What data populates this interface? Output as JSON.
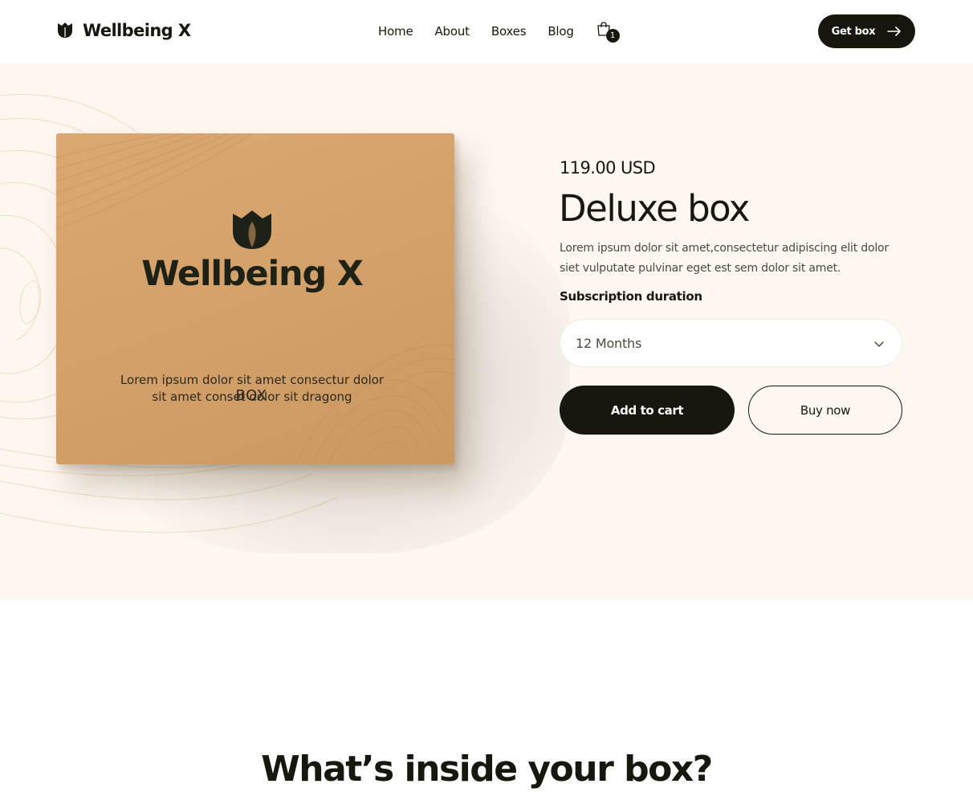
{
  "header": {
    "brand": "Wellbeing X",
    "nav": [
      "Home",
      "About",
      "Boxes",
      "Blog"
    ],
    "cart_count": "1",
    "cta_label": "Get box"
  },
  "hero_image": {
    "brand": "Wellbeing X",
    "tagline_line1": "Lorem ipsum dolor sit amet consectur dolor",
    "tagline_line2": "sit amet conset dolor sit dragong",
    "label": "BOX"
  },
  "product": {
    "price": "119.00 USD",
    "name": "Deluxe box",
    "description_line1": "Lorem ipsum dolor sit amet,consectetur adipiscing elit dolor",
    "description_line2": "siet vulputate pulvinar eget est sem dolor sit amet.",
    "subscription_label": "Subscription duration",
    "subscription_value": "12 Months",
    "add_to_cart": "Add to cart",
    "buy_now": "Buy now"
  },
  "sections": {
    "inside_title": "What’s inside your box?"
  },
  "colors": {
    "primary": "#17170d",
    "hero_bg": "#fdf7ef",
    "box": "#d4a06a"
  },
  "icons": {
    "logo": "tulip-icon",
    "cart": "shopping-bag-icon",
    "cta": "arrow-right-icon",
    "select": "chevron-down-icon"
  }
}
